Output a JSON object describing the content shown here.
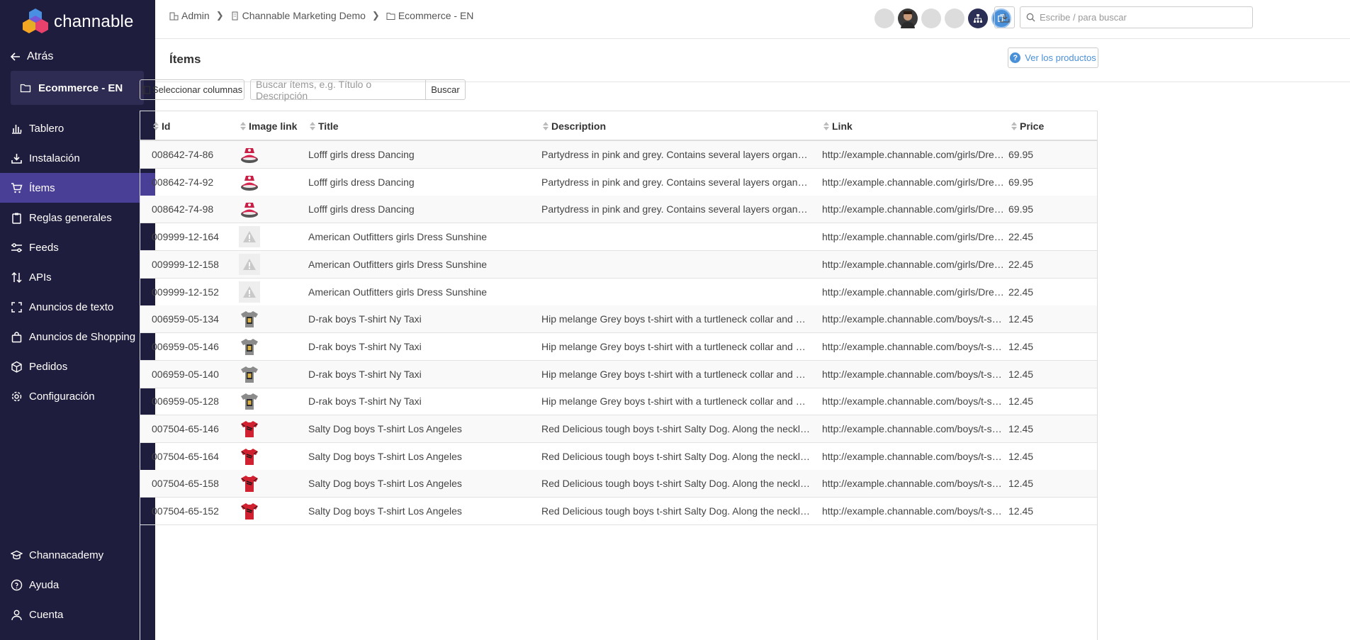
{
  "brand": {
    "name": "channable"
  },
  "sidebar": {
    "back_label": "Atrás",
    "project_label": "Ecommerce - EN",
    "items": [
      {
        "label": "Tablero",
        "icon": "bar-chart-icon"
      },
      {
        "label": "Instalación",
        "icon": "download-tray-icon"
      },
      {
        "label": "Ítems",
        "icon": "cart-icon"
      },
      {
        "label": "Reglas generales",
        "icon": "clipboard-icon"
      },
      {
        "label": "Feeds",
        "icon": "sliders-icon"
      },
      {
        "label": "APIs",
        "icon": "sort-arrows-icon"
      },
      {
        "label": "Anuncios de texto",
        "icon": "text-frame-icon"
      },
      {
        "label": "Anuncios de Shopping",
        "icon": "shopping-bag-icon"
      },
      {
        "label": "Pedidos",
        "icon": "box-icon"
      },
      {
        "label": "Configuración",
        "icon": "gear-icon"
      }
    ],
    "bottom": [
      {
        "label": "Channacademy",
        "icon": "graduation-cap-icon"
      },
      {
        "label": "Ayuda",
        "icon": "help-circle-icon"
      },
      {
        "label": "Cuenta",
        "icon": "user-icon"
      }
    ]
  },
  "header": {
    "breadcrumbs": [
      {
        "label": "Admin",
        "icon": "org-icon"
      },
      {
        "label": "Channable Marketing Demo",
        "icon": "building-icon"
      },
      {
        "label": "Ecommerce - EN",
        "icon": "folder-icon"
      }
    ],
    "search_placeholder": "Escribe / para buscar"
  },
  "page": {
    "title": "Ítems",
    "view_products_label": "Ver los productos",
    "select_columns_label": "Seleccionar columnas",
    "item_search_placeholder": "Buscar ítems, e.g. Título o Descripción",
    "item_search_button": "Buscar"
  },
  "table": {
    "columns": [
      "Id",
      "Image link",
      "Title",
      "Description",
      "Link",
      "Price"
    ],
    "rows": [
      {
        "id": "008642-74-86",
        "img": "dress",
        "title": "Lofff girls dress Dancing",
        "description": "Partydress in pink and grey. Contains several layers organza. From t...",
        "link": "http://example.channable.com/girls/Dresse...",
        "price": "69.95"
      },
      {
        "id": "008642-74-92",
        "img": "dress",
        "title": "Lofff girls dress Dancing",
        "description": "Partydress in pink and grey. Contains several layers organza. From t...",
        "link": "http://example.channable.com/girls/Dresse...",
        "price": "69.95"
      },
      {
        "id": "008642-74-98",
        "img": "dress",
        "title": "Lofff girls dress Dancing",
        "description": "Partydress in pink and grey. Contains several layers organza. From t...",
        "link": "http://example.channable.com/girls/Dresse...",
        "price": "69.95"
      },
      {
        "id": "009999-12-164",
        "img": "missing",
        "title": "American Outfitters girls Dress Sunshine",
        "description": "",
        "link": "http://example.channable.com/girls/Dresse...",
        "price": "22.45"
      },
      {
        "id": "009999-12-158",
        "img": "missing",
        "title": "American Outfitters girls Dress Sunshine",
        "description": "",
        "link": "http://example.channable.com/girls/Dresse...",
        "price": "22.45"
      },
      {
        "id": "009999-12-152",
        "img": "missing",
        "title": "American Outfitters girls Dress Sunshine",
        "description": "",
        "link": "http://example.channable.com/girls/Dresse...",
        "price": "22.45"
      },
      {
        "id": "006959-05-134",
        "img": "grey-shirt",
        "title": "D-rak boys T-shirt Ny Taxi",
        "description": "Hip melange Grey boys t-shirt with a turtleneck collar and a black co...",
        "link": "http://example.channable.com/boys/t-shirt...",
        "price": "12.45"
      },
      {
        "id": "006959-05-146",
        "img": "grey-shirt",
        "title": "D-rak boys T-shirt Ny Taxi",
        "description": "Hip melange Grey boys t-shirt with a turtleneck collar and a black co...",
        "link": "http://example.channable.com/boys/t-shirt...",
        "price": "12.45"
      },
      {
        "id": "006959-05-140",
        "img": "grey-shirt",
        "title": "D-rak boys T-shirt Ny Taxi",
        "description": "Hip melange Grey boys t-shirt with a turtleneck collar and a black co...",
        "link": "http://example.channable.com/boys/t-shirt...",
        "price": "12.45"
      },
      {
        "id": "006959-05-128",
        "img": "grey-shirt",
        "title": "D-rak boys T-shirt Ny Taxi",
        "description": "Hip melange Grey boys t-shirt with a turtleneck collar and a black co...",
        "link": "http://example.channable.com/boys/t-shirt...",
        "price": "12.45"
      },
      {
        "id": "007504-65-146",
        "img": "red-shirt",
        "title": "Salty Dog boys T-shirt Los Angeles",
        "description": "Red Delicious tough boys t-shirt Salty Dog. Along the neckline is an ...",
        "link": "http://example.channable.com/boys/t-shirt...",
        "price": "12.45"
      },
      {
        "id": "007504-65-164",
        "img": "red-shirt",
        "title": "Salty Dog boys T-shirt Los Angeles",
        "description": "Red Delicious tough boys t-shirt Salty Dog. Along the neckline is an ...",
        "link": "http://example.channable.com/boys/t-shirt...",
        "price": "12.45"
      },
      {
        "id": "007504-65-158",
        "img": "red-shirt",
        "title": "Salty Dog boys T-shirt Los Angeles",
        "description": "Red Delicious tough boys t-shirt Salty Dog. Along the neckline is an ...",
        "link": "http://example.channable.com/boys/t-shirt...",
        "price": "12.45"
      },
      {
        "id": "007504-65-152",
        "img": "red-shirt",
        "title": "Salty Dog boys T-shirt Los Angeles",
        "description": "Red Delicious tough boys t-shirt Salty Dog. Along the neckline is an ...",
        "link": "http://example.channable.com/boys/t-shirt...",
        "price": "12.45"
      }
    ]
  },
  "colors": {
    "sidebar_bg": "#1f1d3d",
    "active_item": "#4a3f97",
    "accent": "#4a90d9"
  }
}
